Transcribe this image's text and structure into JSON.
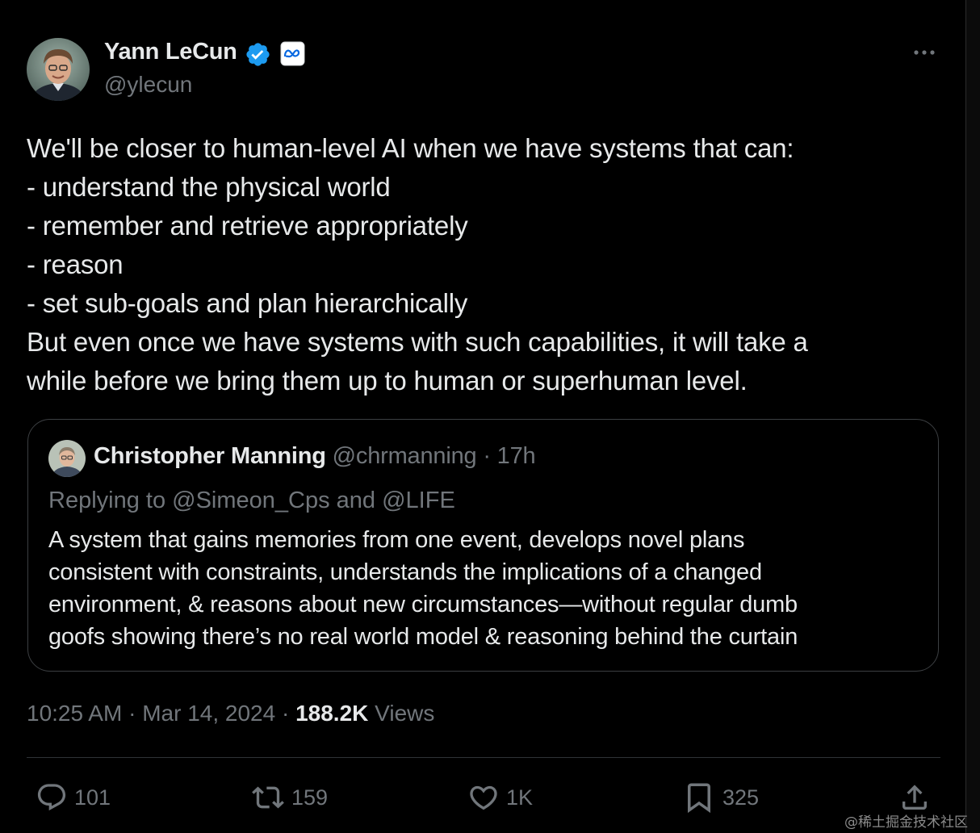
{
  "author": {
    "name": "Yann LeCun",
    "handle": "@ylecun",
    "verified_icon": "verified-badge-icon",
    "affiliation_icon": "meta-logo-icon"
  },
  "tweet": {
    "lines": [
      "We'll be closer to human-level AI when we have systems that can:",
      "- understand the physical world",
      "- remember and retrieve appropriately",
      "- reason",
      "- set sub-goals and plan hierarchically",
      "But even once we have systems with such capabilities, it will take a",
      "while before we bring them up to human or superhuman level."
    ]
  },
  "quote": {
    "name": "Christopher Manning",
    "handle": "@chrmanning",
    "separator": "·",
    "time": "17h",
    "replying_to": "Replying to @Simeon_Cps and @LIFE",
    "lines": [
      "A system that gains memories from one event, develops novel plans",
      "consistent with constraints, understands the implications of a changed",
      "environment, & reasons about new circumstances—without regular dumb",
      "goofs showing there’s no real world model & reasoning behind the curtain"
    ]
  },
  "meta": {
    "time": "10:25 AM",
    "separator": "·",
    "date": "Mar 14, 2024",
    "views_count": "188.2K",
    "views_label": "Views"
  },
  "actions": {
    "replies": "101",
    "reposts": "159",
    "likes": "1K",
    "bookmarks": "325"
  },
  "icons": {
    "more": "more-horizontal-icon",
    "reply": "reply-icon",
    "repost": "repost-icon",
    "like": "heart-icon",
    "bookmark": "bookmark-icon",
    "share": "share-icon"
  },
  "watermark": "@稀土掘金技术社区",
  "colors": {
    "background": "#000000",
    "text_primary": "#e7e9ea",
    "text_secondary": "#71767b",
    "verified_blue": "#1d9bf0",
    "border": "#2f3336"
  }
}
